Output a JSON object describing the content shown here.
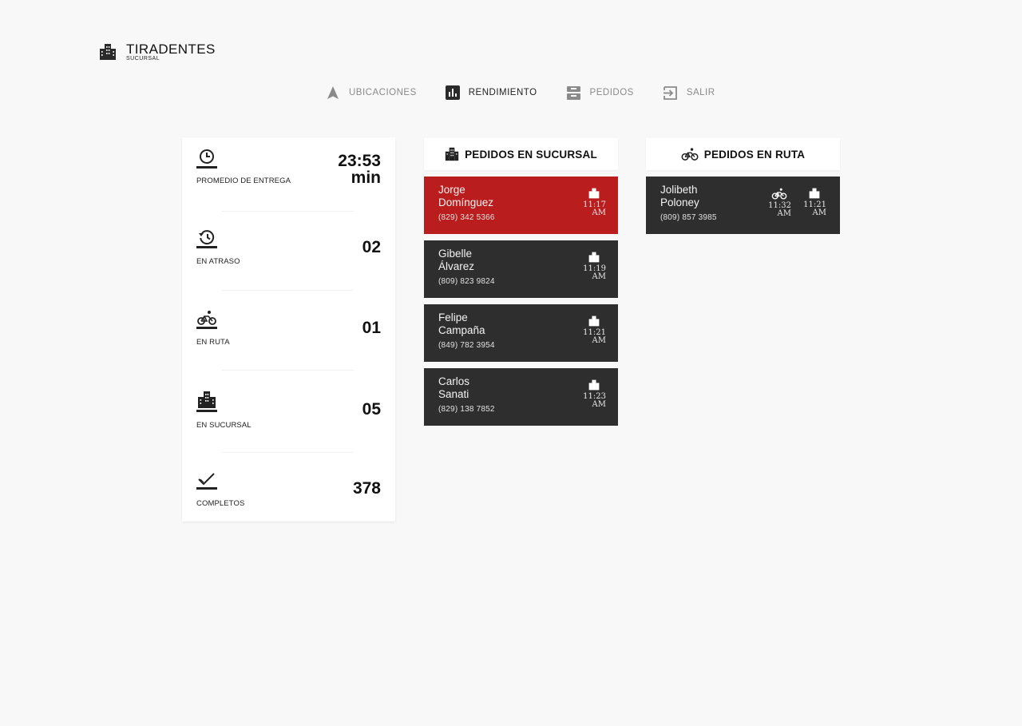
{
  "brand": {
    "title": "TIRADENTES",
    "subtitle": "SUCURSAL",
    "icon": "building-icon"
  },
  "nav": [
    {
      "label": "UBICACIONES",
      "icon": "navigation-arrow-icon",
      "active": false
    },
    {
      "label": "RENDIMIENTO",
      "icon": "bar-chart-icon",
      "active": true
    },
    {
      "label": "PEDIDOS",
      "icon": "inbox-icon",
      "active": false
    },
    {
      "label": "SALIR",
      "icon": "logout-icon",
      "active": false
    }
  ],
  "stats": [
    {
      "label": "PROMEDIO DE ENTREGA",
      "value": "23:53",
      "unit": "min",
      "icon": "clock-icon"
    },
    {
      "label": "EN ATRASO",
      "value": "02",
      "icon": "history-icon"
    },
    {
      "label": "EN RUTA",
      "value": "01",
      "icon": "bicycle-icon"
    },
    {
      "label": "EN SUCURSAL",
      "value": "05",
      "icon": "building-icon"
    },
    {
      "label": "COMPLETOS",
      "value": "378",
      "icon": "check-icon"
    }
  ],
  "branch_orders": {
    "title": "PEDIDOS EN SUCURSAL",
    "icon": "building-icon",
    "items": [
      {
        "name_line1": "Jorge",
        "name_line2": "Domínguez",
        "phone": "(829) 342 5366",
        "time": "11:17",
        "ampm": "AM",
        "late": true,
        "status_icon": "building-icon"
      },
      {
        "name_line1": "Gibelle",
        "name_line2": "Álvarez",
        "phone": "(809) 823 9824",
        "time": "11:19",
        "ampm": "AM",
        "late": false,
        "status_icon": "building-icon"
      },
      {
        "name_line1": "Felipe",
        "name_line2": "Campaña",
        "phone": "(849) 782 3954",
        "time": "11:21",
        "ampm": "AM",
        "late": false,
        "status_icon": "building-icon"
      },
      {
        "name_line1": "Carlos",
        "name_line2": "Sanati",
        "phone": "(829) 138 7852",
        "time": "11:23",
        "ampm": "AM",
        "late": false,
        "status_icon": "building-icon"
      }
    ]
  },
  "route_orders": {
    "title": "PEDIDOS EN RUTA",
    "icon": "bicycle-icon",
    "items": [
      {
        "name_line1": "Jolibeth",
        "name_line2": "Poloney",
        "phone": "(809) 857 3985",
        "route_time": "11:32",
        "route_ampm": "AM",
        "branch_time": "11:21",
        "branch_ampm": "AM",
        "route_icon": "bicycle-icon",
        "branch_icon": "building-icon"
      }
    ]
  },
  "colors": {
    "background": "#f8f8f8",
    "card": "#ffffff",
    "order_card": "#2e2e2e",
    "late_order_card": "#b91d1d",
    "nav_inactive": "#8a8a8a",
    "nav_active": "#222222"
  }
}
